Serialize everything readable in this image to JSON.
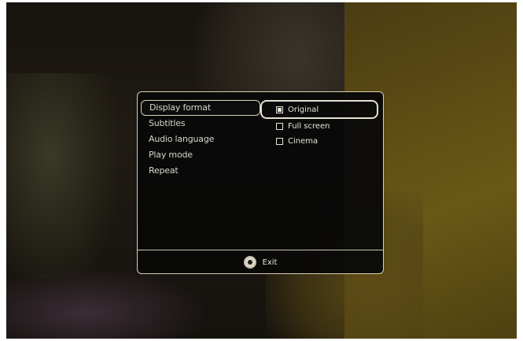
{
  "menu": {
    "items": [
      {
        "label": "Display format"
      },
      {
        "label": "Subtitles"
      },
      {
        "label": "Audio language"
      },
      {
        "label": "Play mode"
      },
      {
        "label": "Repeat"
      }
    ],
    "selected_index": 0
  },
  "options": {
    "items": [
      {
        "label": "Original",
        "checked": true
      },
      {
        "label": "Full screen",
        "checked": false
      },
      {
        "label": "Cinema",
        "checked": false
      }
    ]
  },
  "footer": {
    "exit_label": "Exit",
    "exit_icon": "gear-icon"
  },
  "colors": {
    "panel_background": "#080808",
    "border": "#d9cfb0",
    "text": "#d8d4c8"
  }
}
